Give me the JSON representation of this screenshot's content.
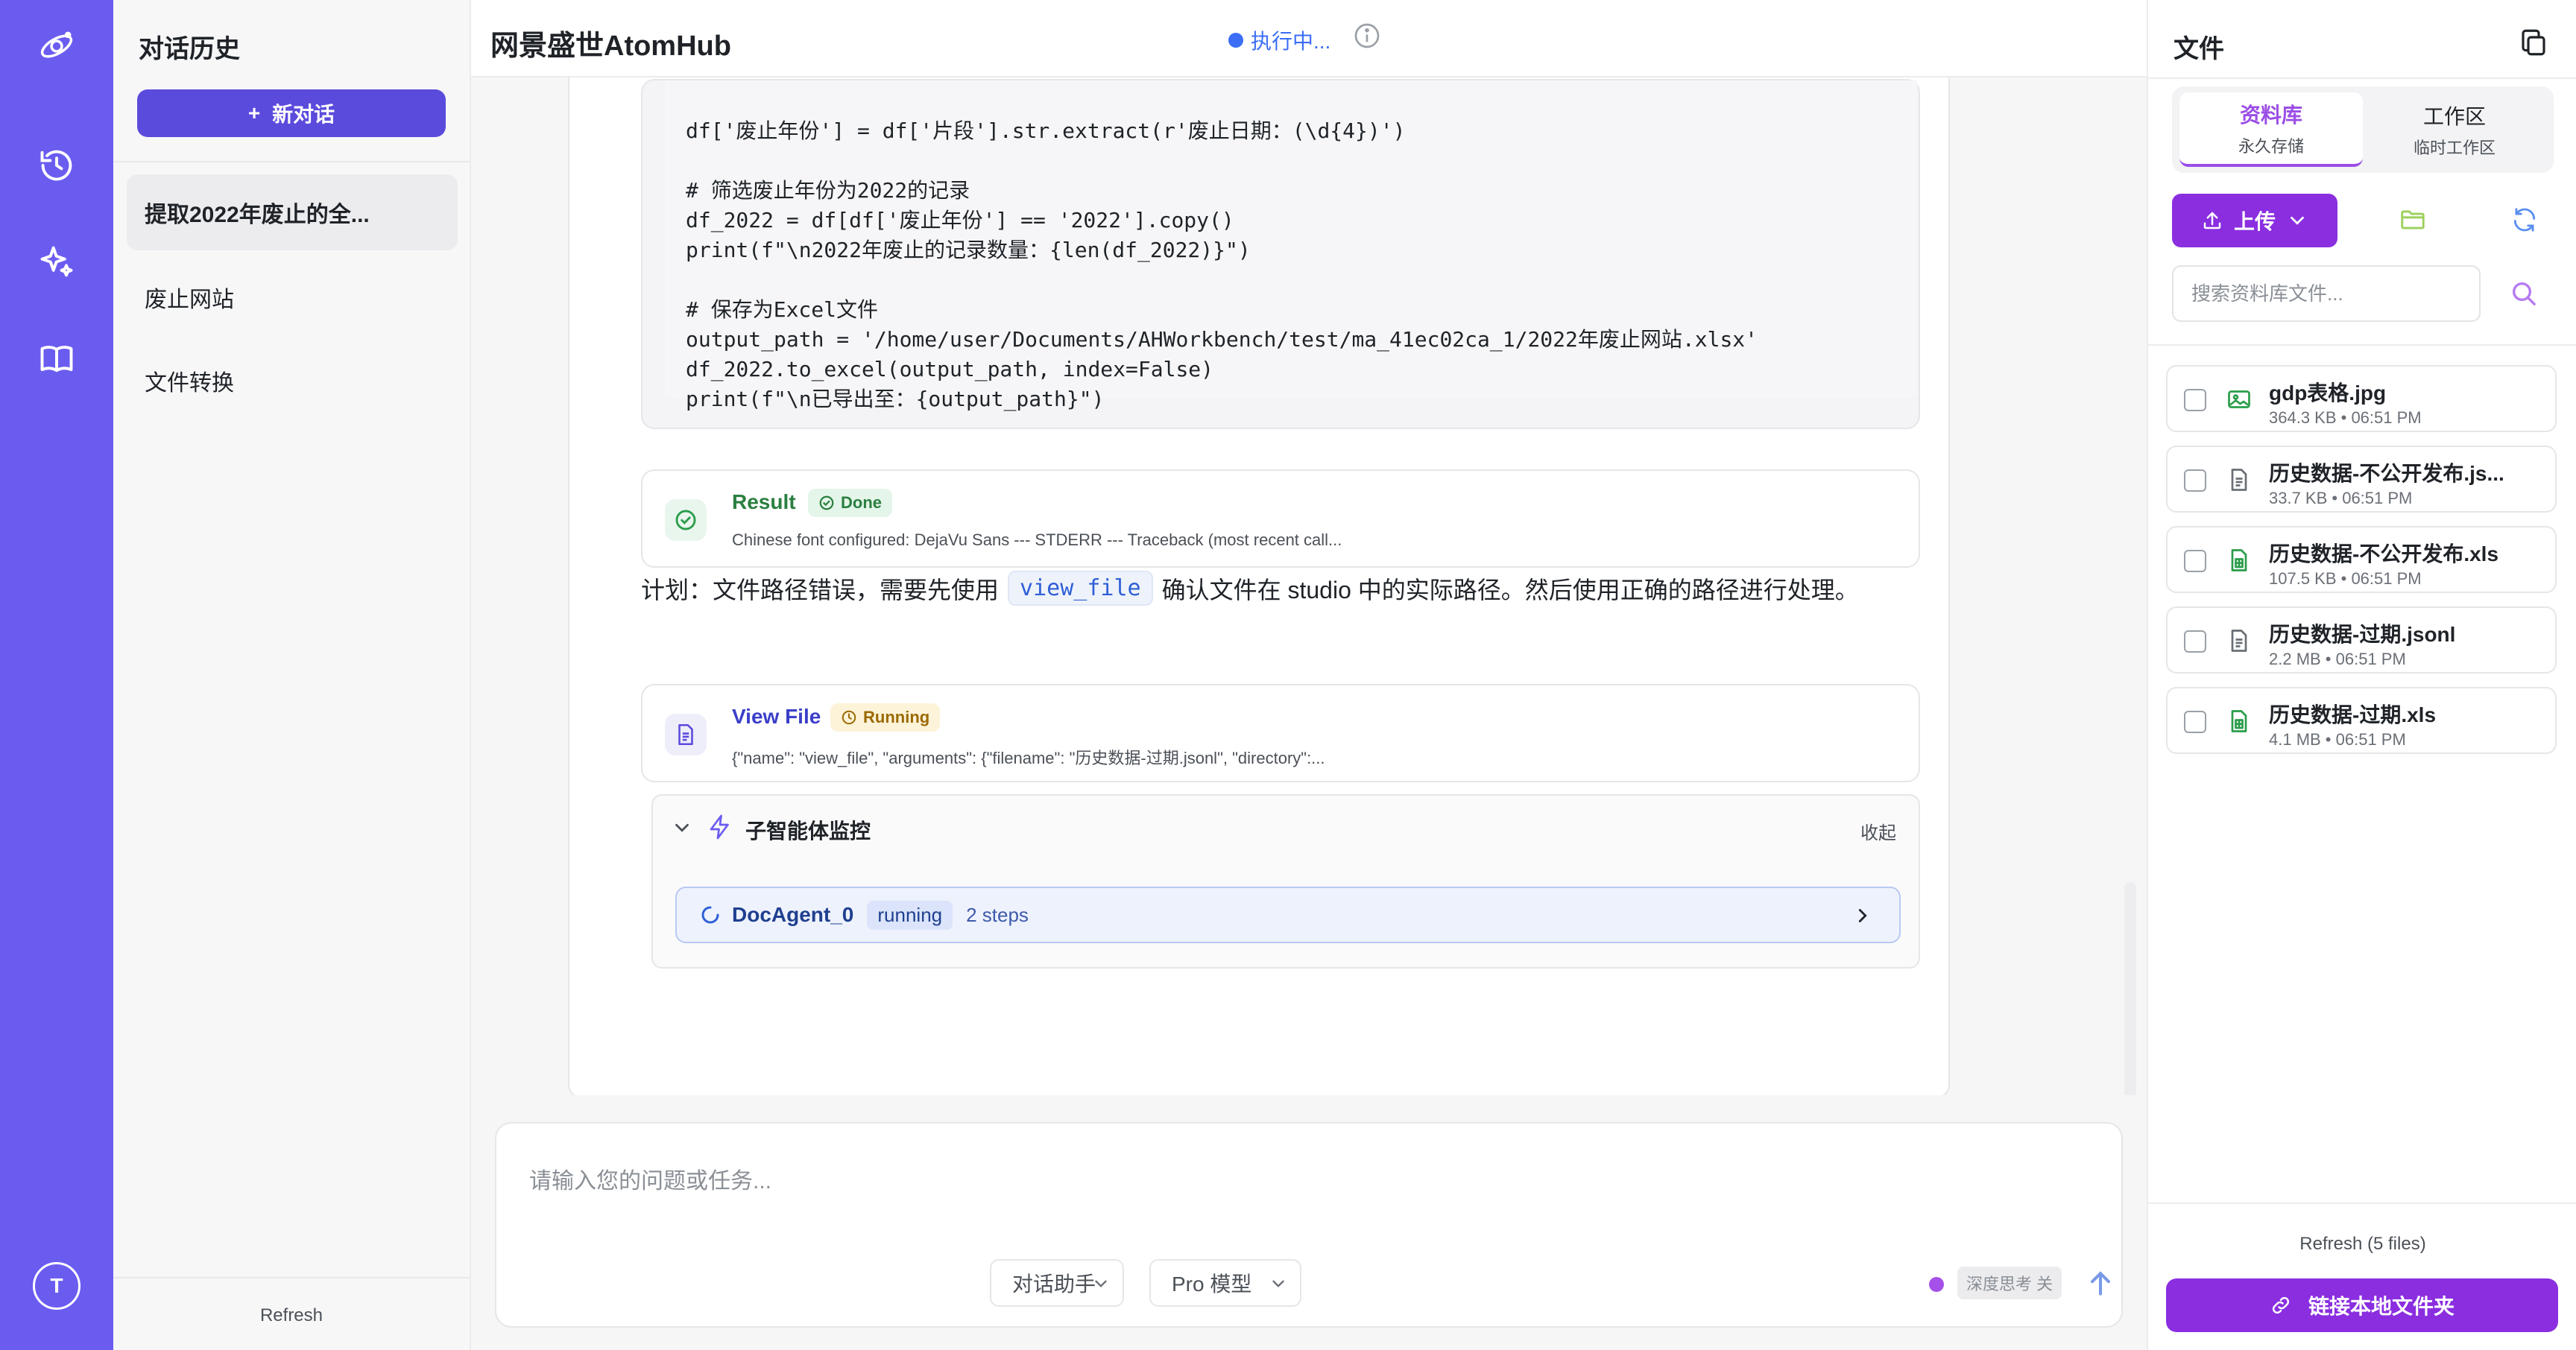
{
  "colors": {
    "rail": "#6b5cf0",
    "primary_button": "#5b4bdc",
    "accent_purple": "#8a2ee0",
    "status_blue": "#3b6ef5",
    "done_green": "#2a9d4a",
    "running_amber": "#b07a00"
  },
  "rail": {
    "icons": [
      "logo-icon",
      "history-icon",
      "sparkle-icon",
      "book-icon"
    ],
    "avatar_initial": "T"
  },
  "history": {
    "title": "对话历史",
    "new_chat_label": "新对话",
    "items": [
      {
        "label": "提取2022年废止的全...",
        "active": true
      },
      {
        "label": "废止网站",
        "active": false
      },
      {
        "label": "文件转换",
        "active": false
      }
    ],
    "refresh_label": "Refresh"
  },
  "header": {
    "title": "网景盛世AtomHub",
    "status_label": "执行中..."
  },
  "code": {
    "lines": [
      "df['废止年份'] = df['片段'].str.extract(r'废止日期：(\\d{4})')",
      "",
      "# 筛选废止年份为2022的记录",
      "df_2022 = df[df['废止年份'] == '2022'].copy()",
      "print(f\"\\n2022年废止的记录数量：{len(df_2022)}\")",
      "",
      "# 保存为Excel文件",
      "output_path = '/home/user/Documents/AHWorkbench/test/ma_41ec02ca_1/2022年废止网站.xlsx'",
      "df_2022.to_excel(output_path, index=False)",
      "print(f\"\\n已导出至：{output_path}\")"
    ]
  },
  "result_card": {
    "name": "Result",
    "badge": "Done",
    "detail": "Chinese font configured: DejaVu Sans --- STDERR --- Traceback (most recent call..."
  },
  "plan": {
    "prefix": "计划：文件路径错误，需要先使用",
    "code": "view_file",
    "suffix": "确认文件在 studio 中的实际路径。然后使用正确的路径进行处理。"
  },
  "view_file_card": {
    "name": "View File",
    "badge": "Running",
    "detail": "{\"name\": \"view_file\", \"arguments\": {\"filename\": \"历史数据-过期.jsonl\", \"directory\":..."
  },
  "monitor": {
    "title": "子智能体监控",
    "collapse_label": "收起",
    "agent": {
      "name": "DocAgent_0",
      "state": "running",
      "steps": "2 steps"
    }
  },
  "composer": {
    "placeholder": "请输入您的问题或任务...",
    "assistant_select": "对话助手",
    "model_select": "Pro 模型",
    "deep_think_label": "深度思考 关"
  },
  "files": {
    "title": "文件",
    "tabs": [
      {
        "label": "资料库",
        "sub": "永久存储"
      },
      {
        "label": "工作区",
        "sub": "临时工作区"
      }
    ],
    "upload_label": "上传",
    "search_placeholder": "搜索资料库文件...",
    "items": [
      {
        "name": "gdp表格.jpg",
        "meta": "364.3 KB • 06:51 PM",
        "icon": "image-file-icon"
      },
      {
        "name": "历史数据-不公开发布.js...",
        "meta": "33.7 KB • 06:51 PM",
        "icon": "document-file-icon"
      },
      {
        "name": "历史数据-不公开发布.xls",
        "meta": "107.5 KB • 06:51 PM",
        "icon": "spreadsheet-file-icon"
      },
      {
        "name": "历史数据-过期.jsonl",
        "meta": "2.2 MB • 06:51 PM",
        "icon": "document-file-icon"
      },
      {
        "name": "历史数据-过期.xls",
        "meta": "4.1 MB • 06:51 PM",
        "icon": "spreadsheet-file-icon"
      }
    ],
    "refresh_label": "Refresh (5 files)",
    "link_folder_label": "链接本地文件夹"
  }
}
